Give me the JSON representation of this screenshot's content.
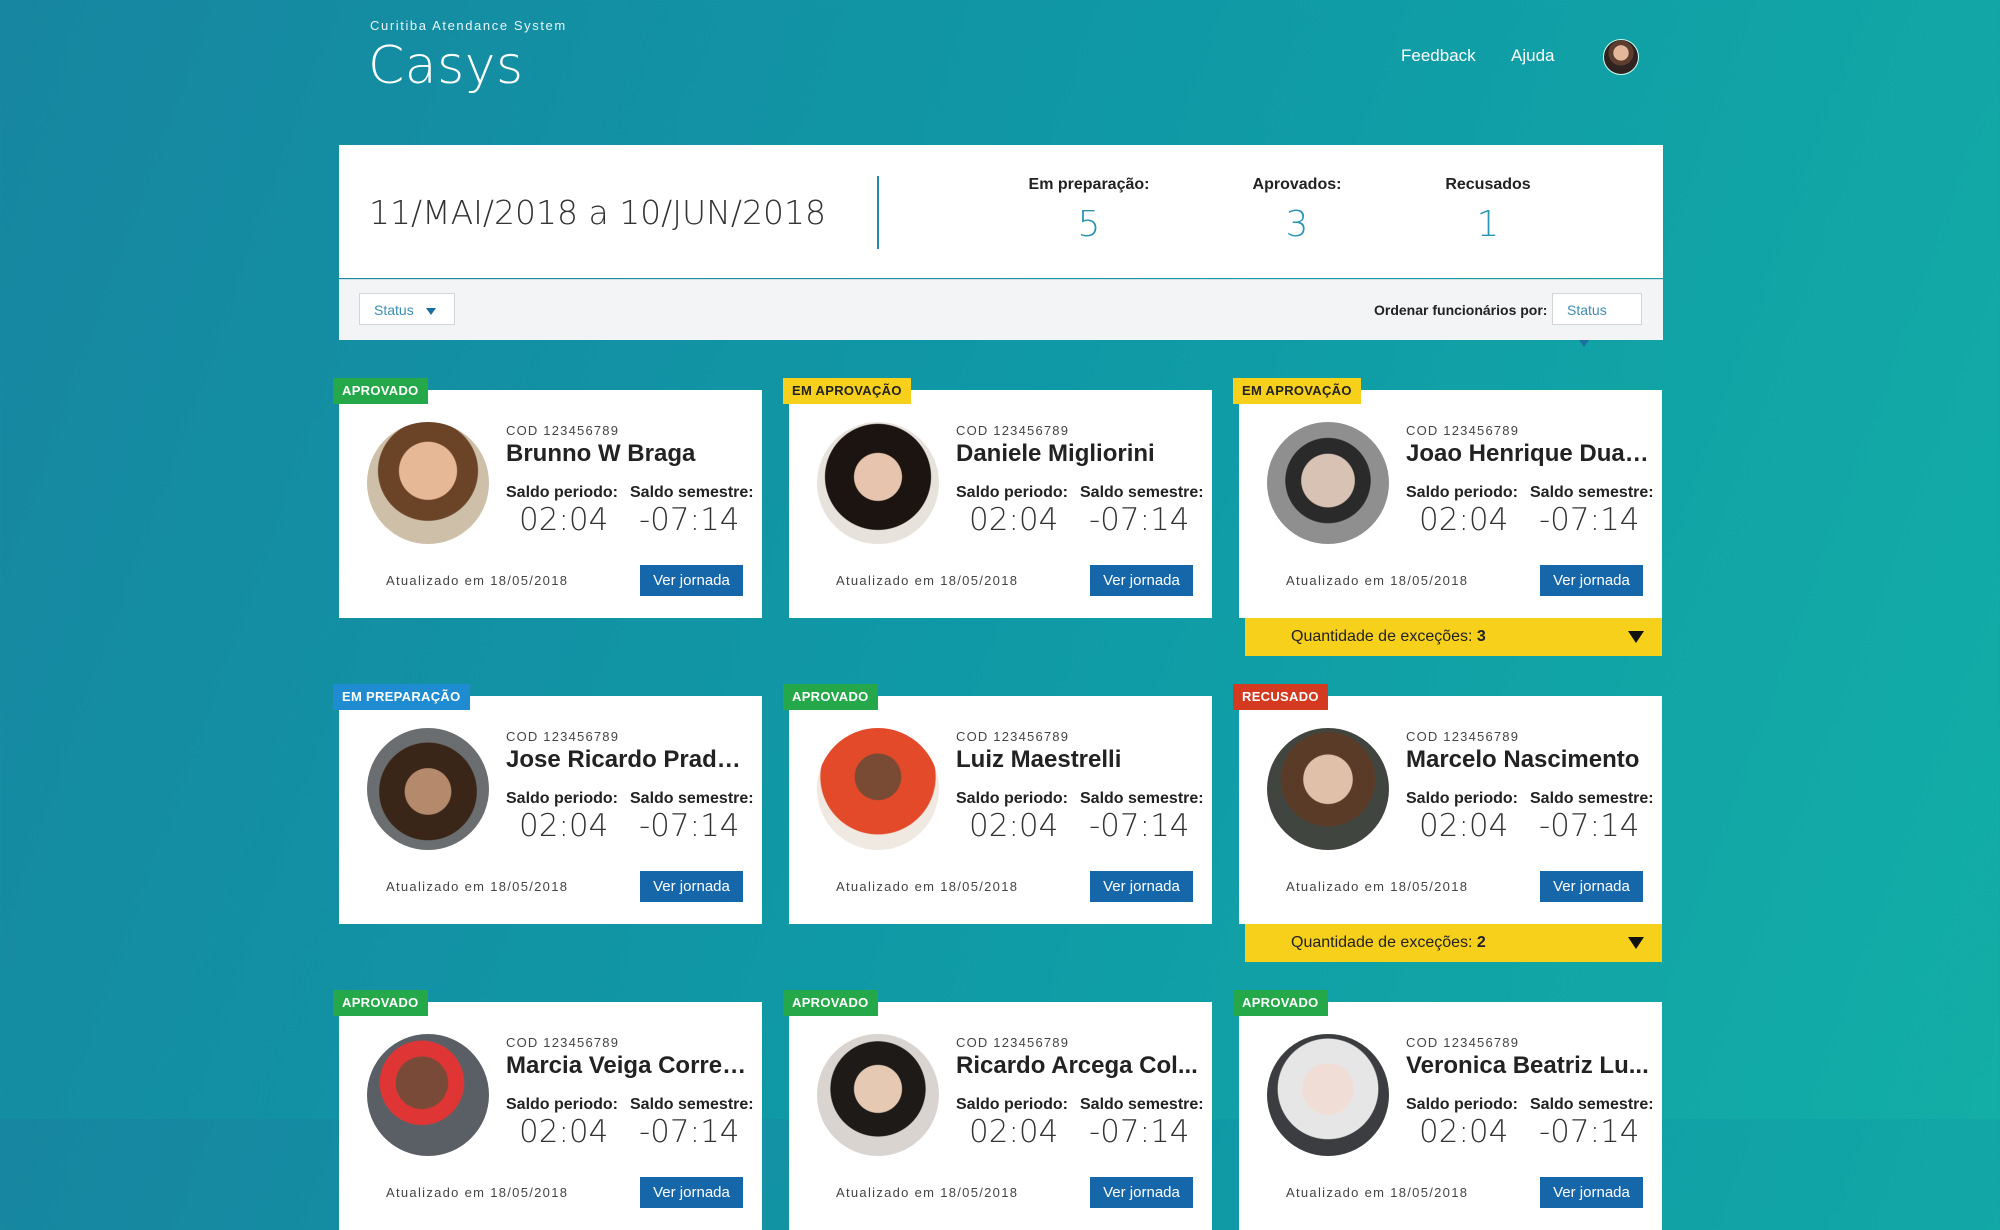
{
  "app": {
    "subtitle": "Curitiba Atendance System",
    "title": "Casys"
  },
  "nav": {
    "feedback": "Feedback",
    "help": "Ajuda"
  },
  "summary": {
    "period": "11/MAI/2018 a 10/JUN/2018",
    "stats": [
      {
        "label": "Em preparação:",
        "value": "5"
      },
      {
        "label": "Aprovados:",
        "value": "3"
      },
      {
        "label": "Recusados",
        "value": "1"
      }
    ]
  },
  "filters": {
    "status": "Status",
    "order_label": "Ordenar funcionários por:",
    "order_value": "Status"
  },
  "labels": {
    "saldo_periodo": "Saldo periodo:",
    "saldo_semestre": "Saldo semestre:",
    "button": "Ver jornada",
    "exceptions": "Quantidade de exceções:"
  },
  "colors": {
    "approved": "#24a84a",
    "in_approval": "#f7d01b",
    "preparation": "#1f8bd0",
    "refused": "#d33a1f",
    "button": "#1667aa",
    "accent": "#2a95b1"
  },
  "employees": [
    {
      "status": "APROVADO",
      "code": "COD 123456789",
      "name": "Brunno W Braga",
      "saldo_periodo": "02:04",
      "saldo_semestre": "-07:14",
      "updated": "Atualizado em 18/05/2018"
    },
    {
      "status": "EM APROVAÇÃO",
      "code": "COD 123456789",
      "name": "Daniele Migliorini",
      "saldo_periodo": "02:04",
      "saldo_semestre": "-07:14",
      "updated": "Atualizado em 18/05/2018"
    },
    {
      "status": "EM APROVAÇÃO",
      "code": "COD 123456789",
      "name": "Joao Henrique Duar...",
      "saldo_periodo": "02:04",
      "saldo_semestre": "-07:14",
      "updated": "Atualizado em 18/05/2018",
      "exceptions": "3"
    },
    {
      "status": "EM PREPARAÇÃO",
      "code": "COD 123456789",
      "name": "Jose Ricardo Prado...",
      "saldo_periodo": "02:04",
      "saldo_semestre": "-07:14",
      "updated": "Atualizado em 18/05/2018"
    },
    {
      "status": "APROVADO",
      "code": "COD 123456789",
      "name": "Luiz Maestrelli",
      "saldo_periodo": "02:04",
      "saldo_semestre": "-07:14",
      "updated": "Atualizado em 18/05/2018"
    },
    {
      "status": "RECUSADO",
      "code": "COD 123456789",
      "name": "Marcelo Nascimento",
      "saldo_periodo": "02:04",
      "saldo_semestre": "-07:14",
      "updated": "Atualizado em 18/05/2018",
      "exceptions": "2"
    },
    {
      "status": "APROVADO",
      "code": "COD 123456789",
      "name": "Marcia Veiga Corren...",
      "saldo_periodo": "02:04",
      "saldo_semestre": "-07:14",
      "updated": "Atualizado em 18/05/2018"
    },
    {
      "status": "APROVADO",
      "code": "COD 123456789",
      "name": "Ricardo Arcega Col...",
      "saldo_periodo": "02:04",
      "saldo_semestre": "-07:14",
      "updated": "Atualizado em 18/05/2018"
    },
    {
      "status": "APROVADO",
      "code": "COD 123456789",
      "name": "Veronica Beatriz Lu...",
      "saldo_periodo": "02:04",
      "saldo_semestre": "-07:14",
      "updated": "Atualizado em 18/05/2018"
    }
  ]
}
